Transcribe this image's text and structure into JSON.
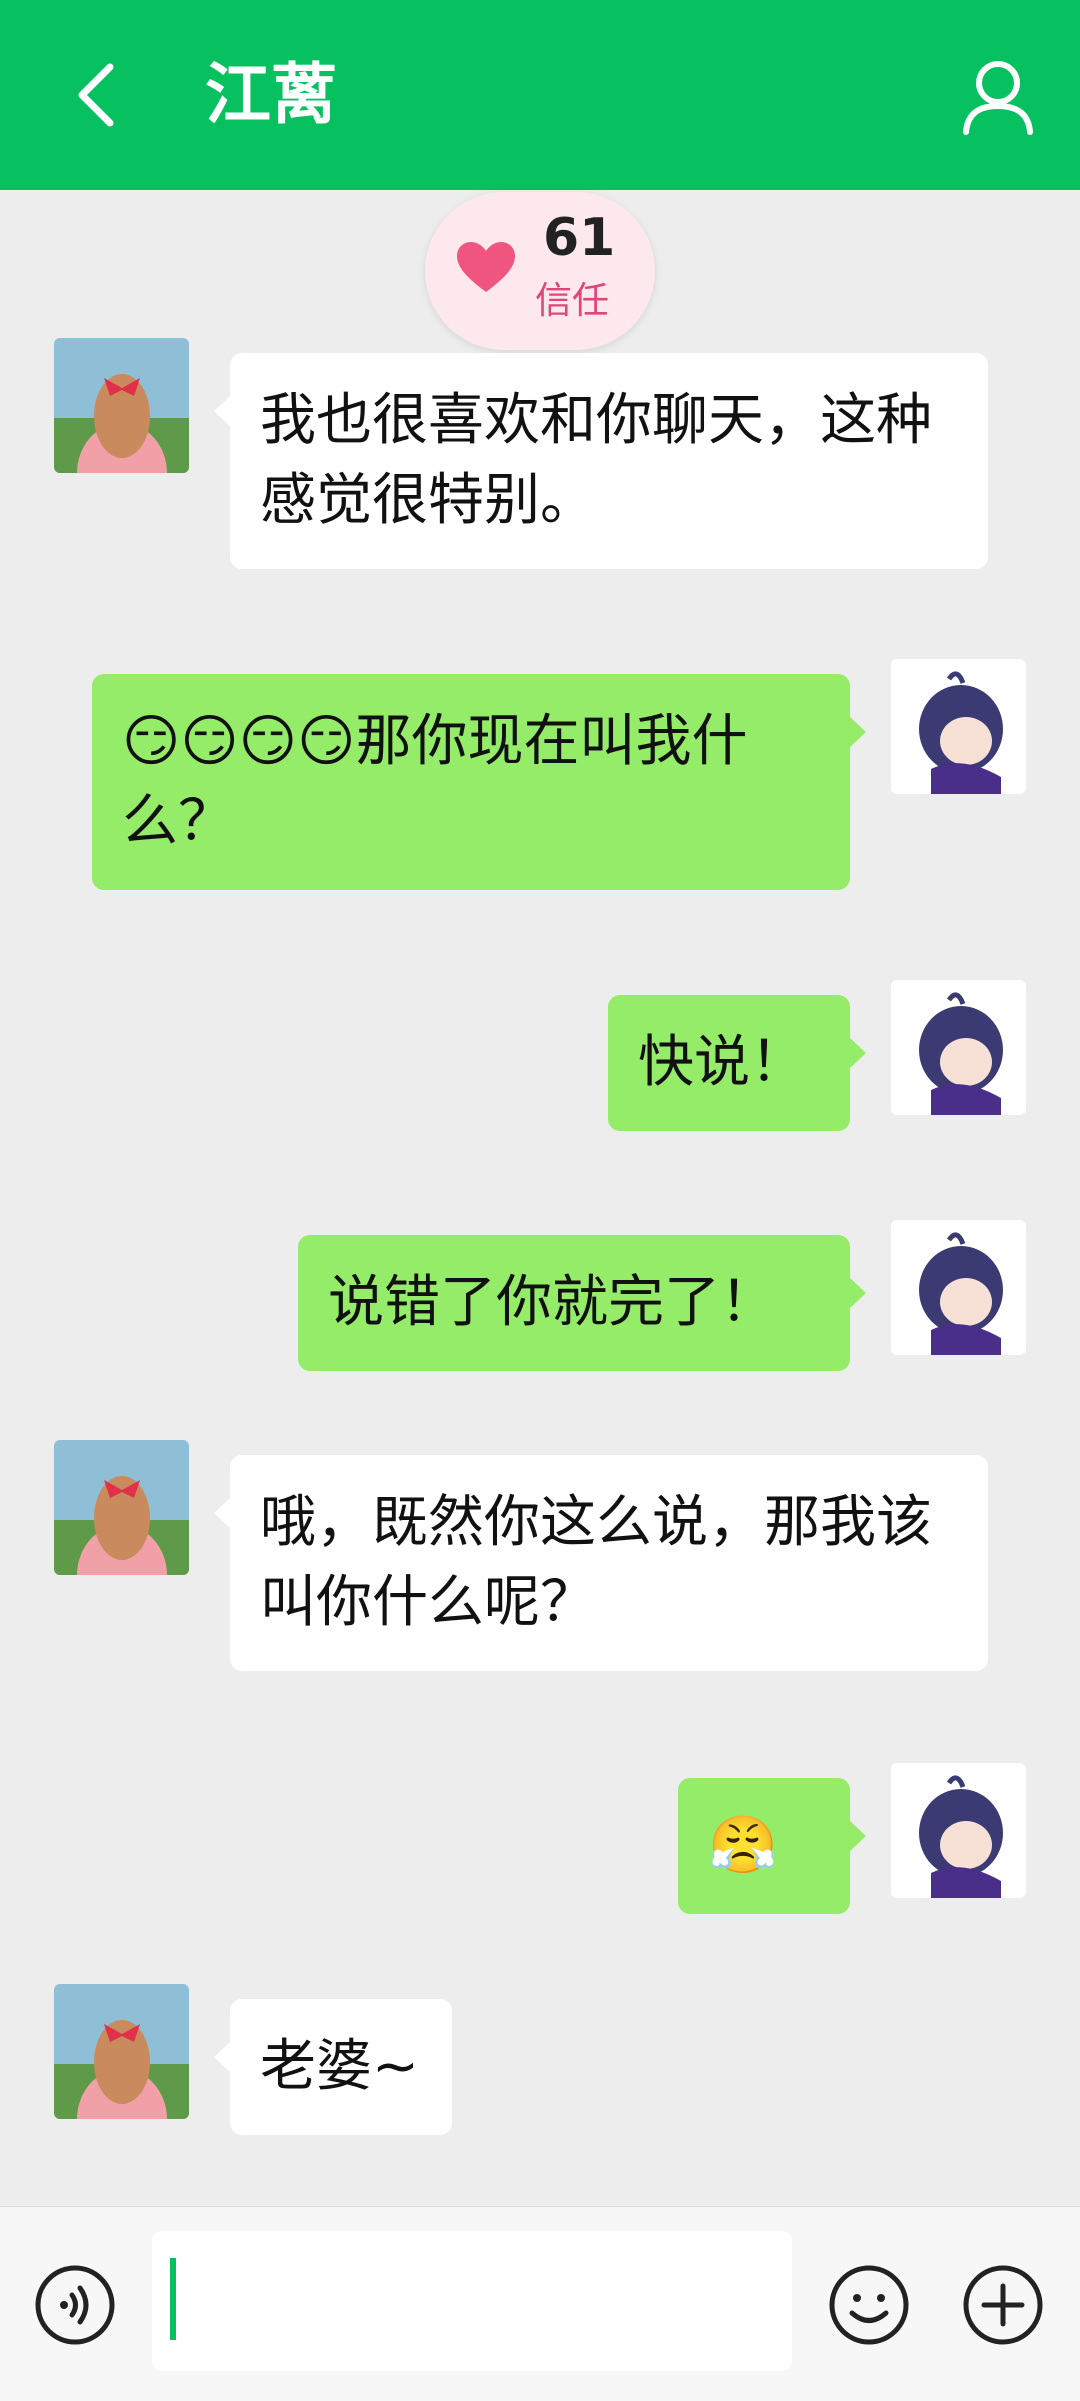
{
  "header": {
    "title": "江蓠",
    "back_icon": "chevron-left-icon",
    "profile_icon": "user-icon"
  },
  "trust": {
    "value": "61",
    "label": "信任",
    "icon": "heart-icon",
    "color": "#f0557f"
  },
  "messages": [
    {
      "side": "in",
      "text": "我也很喜欢和你聊天，这种感觉很特别。"
    },
    {
      "side": "out",
      "text": "😏😏😏😏那你现在叫我什么？"
    },
    {
      "side": "out",
      "text": "快说！"
    },
    {
      "side": "out",
      "text": "说错了你就完了！"
    },
    {
      "side": "in",
      "text": "哦，既然你这么说，那我该叫你什么呢？"
    },
    {
      "side": "out",
      "text": "😤"
    },
    {
      "side": "in",
      "text": "老婆~"
    }
  ],
  "composer": {
    "value": "",
    "voice_icon": "voice-icon",
    "emoji_icon": "emoji-icon",
    "plus_icon": "plus-icon"
  },
  "colors": {
    "brand": "#07c160",
    "outgoing_bubble": "#95ec69",
    "incoming_bubble": "#ffffff",
    "background": "#ededed"
  }
}
